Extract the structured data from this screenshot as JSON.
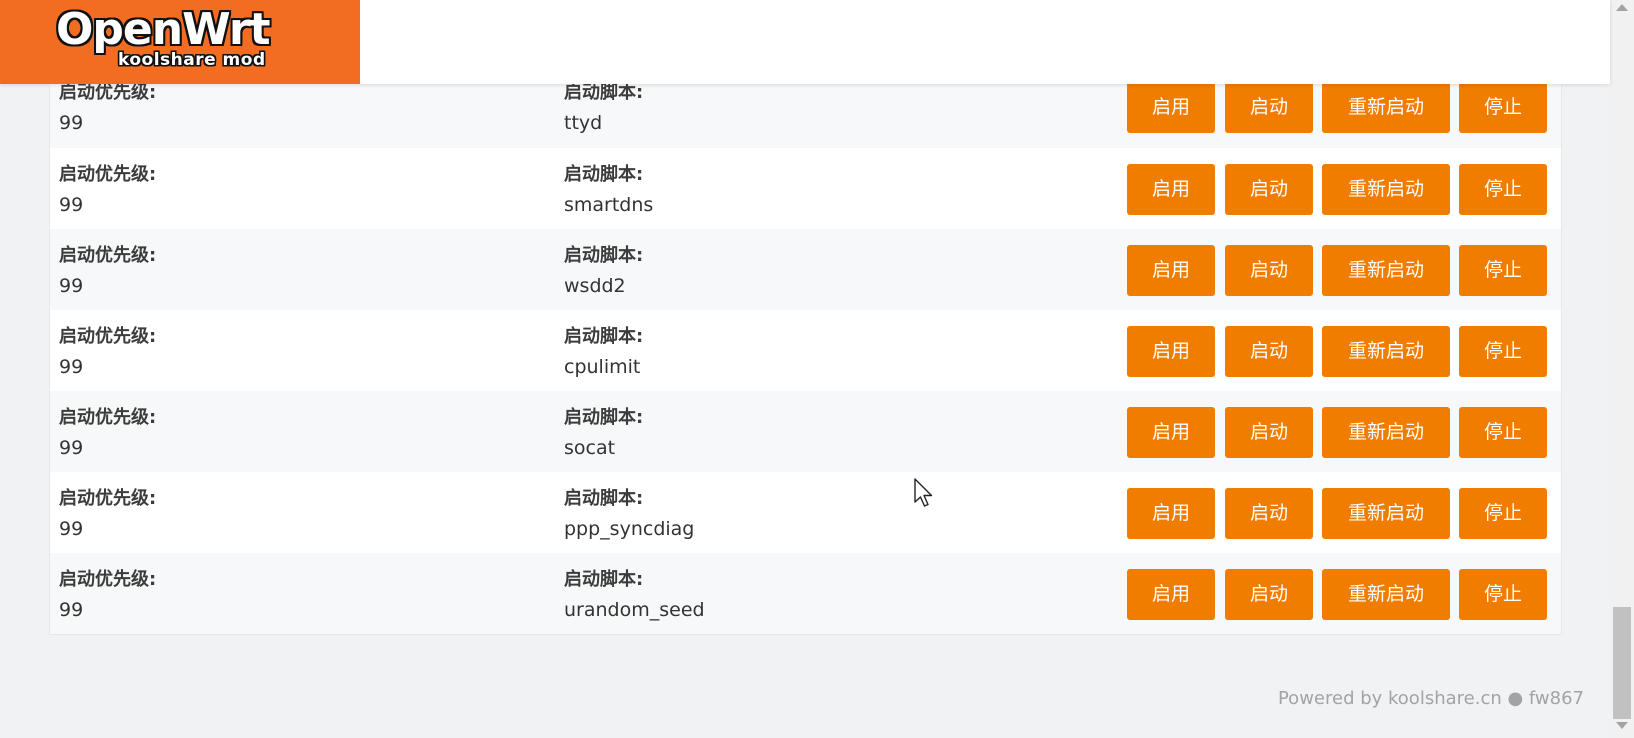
{
  "header": {
    "logo_main": "OpenWrt",
    "logo_sub": "koolshare mod",
    "brand_color": "#f26d21"
  },
  "labels": {
    "priority": "启动优先级:",
    "script": "启动脚本:"
  },
  "buttons": {
    "enable": "启用",
    "start": "启动",
    "restart": "重新启动",
    "stop": "停止",
    "color": "#f07c00"
  },
  "rows": [
    {
      "priority": "99",
      "script": "ttyd"
    },
    {
      "priority": "99",
      "script": "smartdns"
    },
    {
      "priority": "99",
      "script": "wsdd2"
    },
    {
      "priority": "99",
      "script": "cpulimit"
    },
    {
      "priority": "99",
      "script": "socat"
    },
    {
      "priority": "99",
      "script": "ppp_syncdiag"
    },
    {
      "priority": "99",
      "script": "urandom_seed"
    }
  ],
  "footer": {
    "text": "Powered by koolshare.cn ● fw867"
  }
}
